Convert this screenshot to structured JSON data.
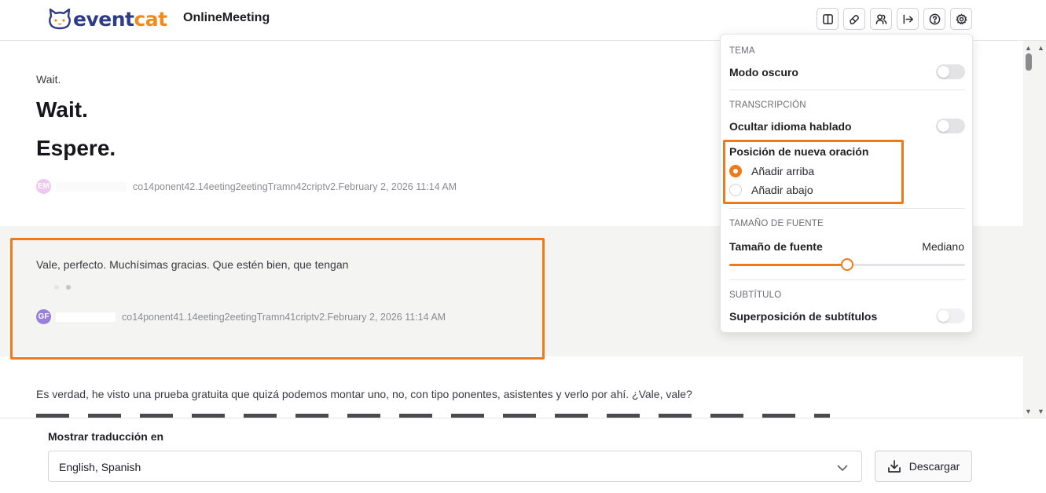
{
  "header": {
    "logo_part1": "event",
    "logo_part2": "cat",
    "app_title": "OnlineMeeting",
    "toolbar_icons": [
      "split-view-icon",
      "eraser-icon",
      "users-icon",
      "exit-icon",
      "help-icon",
      "settings-icon"
    ]
  },
  "transcript": {
    "entries": [
      {
        "source": "Wait.",
        "lines": [
          "Wait.",
          "Espere."
        ],
        "avatar": "EM",
        "avatar_color": "#f0c7ee",
        "meta": "co14ponent42.14eeting2eetingTramn42criptv2.February 2, 2026 11:14 AM"
      },
      {
        "source": "Vale, perfecto. Muchísimas gracias. Que estén bien, que tengan",
        "avatar": "GF",
        "avatar_color": "#9b7fdc",
        "meta": "co14ponent41.14eeting2eetingTramn41criptv2.February 2, 2026 11:14 AM"
      },
      {
        "source": "Es verdad, he visto una prueba gratuita que quizá podemos montar uno, no, con tipo ponentes, asistentes y verlo por ahí. ¿Vale, vale?"
      }
    ]
  },
  "settings": {
    "tema_label": "TEMA",
    "modo_oscuro": "Modo oscuro",
    "transcripcion_label": "TRANSCRIPCIÓN",
    "ocultar_idioma": "Ocultar idioma hablado",
    "posicion_label": "Posición de nueva oración",
    "radio_options": [
      "Añadir arriba",
      "Añadir abajo"
    ],
    "radio_selected": 0,
    "tamano_label": "TAMAÑO DE FUENTE",
    "tamano_row": "Tamaño de fuente",
    "tamano_value": "Mediano",
    "font_slider_fraction": 0.5,
    "subtitulo_label": "SUBTÍTULO",
    "superposicion": "Superposición de subtítulos"
  },
  "footer": {
    "label": "Mostrar traducción en",
    "selected": "English, Spanish",
    "download": "Descargar"
  },
  "colors": {
    "accent": "#f07a1a",
    "brand_blue": "#2e3b86",
    "brand_orange": "#f08a1c"
  }
}
